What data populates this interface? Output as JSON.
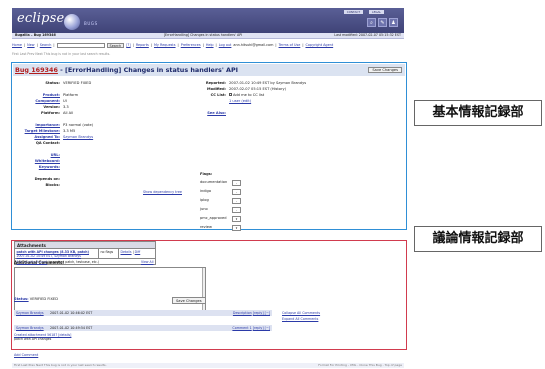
{
  "banner": {
    "wordmark": "eclipse",
    "sub": "BUGS",
    "toplinks": [
      "CONTACT",
      "LEGAL"
    ],
    "icons": [
      "search-icon",
      "edit-icon",
      "user-icon"
    ],
    "icon_glyphs": [
      "⌕",
      "✎",
      "♟"
    ]
  },
  "header": {
    "left": "Bugzilla – Bug 169346",
    "center": "[ErrorHandling] Changes in status handlers' API",
    "right": "Last modified: 2007-02-07 05:15:32 EST"
  },
  "nav": {
    "home": "Home",
    "new": "New",
    "search": "Search",
    "search_button": "Search",
    "help": "[?]",
    "reports": "Reports",
    "my_requests": "My Requests",
    "preferences": "Preferences",
    "help2": "Help",
    "logout": "Log out",
    "user": "ann.hitsuhi@gmail.com",
    "terms": "Terms of Use",
    "copyright": "Copyright Agent",
    "sep": "|"
  },
  "hint": "First Last Prev Next    This bug is not in your last search results.",
  "bug": {
    "number": "Bug 169346",
    "title": " - [ErrorHandling] Changes in status handlers' API",
    "save_label": "Save Changes",
    "left_fields": [
      {
        "k": "Status:",
        "v": "VERIFIED FIXED"
      },
      {
        "k": "",
        "v": ""
      },
      {
        "k": "Product:",
        "v": "Platform"
      },
      {
        "k": "Component:",
        "v": "UI"
      },
      {
        "k": "Version:",
        "v": "3.3"
      },
      {
        "k": "Platform:",
        "v": "All All"
      },
      {
        "k": "",
        "v": ""
      },
      {
        "k": "Importance:",
        "v": "P3 normal (vote)"
      },
      {
        "k": "Target Milestone:",
        "v": "3.3 M5"
      },
      {
        "k": "Assigned To:",
        "v": "Szymon Brandys"
      },
      {
        "k": "QA Contact:",
        "v": ""
      },
      {
        "k": "",
        "v": ""
      },
      {
        "k": "URL:",
        "v": ""
      },
      {
        "k": "Whiteboard:",
        "v": ""
      },
      {
        "k": "Keywords:",
        "v": ""
      },
      {
        "k": "",
        "v": ""
      },
      {
        "k": "Depends on:",
        "v": ""
      },
      {
        "k": "Blocks:",
        "v": ""
      }
    ],
    "dependency_text": "Show dependency tree",
    "reported_label": "Reported:",
    "reported_value": "2007-01-02 10:49 EST by Szymon Brandys",
    "modified_label": "Modified:",
    "modified_value": "2007-02-07 05:15 EST (History)",
    "cc_label": "CC List:",
    "cc_value": "Add me to CC list",
    "cc_users": "1 user (edit)",
    "see_also": "See Also:",
    "flags_title": "Flags:",
    "flags": [
      {
        "name": "documentation",
        "value": "-"
      },
      {
        "name": "indigo",
        "value": "-"
      },
      {
        "name": "iplog",
        "value": "-"
      },
      {
        "name": "juno",
        "value": "-"
      },
      {
        "name": "pmc_approved",
        "value": "▾"
      },
      {
        "name": "review",
        "value": "▾"
      }
    ]
  },
  "attachments": {
    "title": "Attachments",
    "row": {
      "name": "patch with API changes (8.33 KB, patch)",
      "date": "2007-01-02 10:49 EST, Szymon Brandys",
      "flags": "no flags",
      "details": "Details",
      "diff": "Diff"
    },
    "add": "Add an attachment",
    "add_note": "(proposed patch, testcase, etc.)",
    "view_all": "View All"
  },
  "comments_section": {
    "label": "Additional Comments:",
    "status_label": "Status:",
    "status_value": "VERIFIED FIXED",
    "save_label": "Save Changes",
    "comments": [
      {
        "author": "Szymon Brandys",
        "date": "2007-01-02 10:46:02 EST",
        "ref": "Description",
        "links": "[reply] [−]"
      },
      {
        "author": "Szymon Brandys",
        "date": "2007-01-02 10:49:54 EST",
        "ref": "Comment 1",
        "links": "[reply] [−]"
      }
    ],
    "collapse_all": "Collapse All Comments",
    "expand_all": "Expand All Comments",
    "comment1_text": "Created attachment 56187 [details]",
    "comment1_text2": "patch with API changes",
    "add_comment": "Add Comment"
  },
  "footer": {
    "left": "First Last Prev Next    This bug is not in your last search results.",
    "right": "Format For Printing - XML - Clone This Bug - Top of page"
  },
  "annotations": {
    "basic": "基本情報記録部",
    "discussion": "議論情報記録部"
  },
  "colors": {
    "basic_frame": "#2f8fd6",
    "discussion_frame": "#d13b4e",
    "banner": "#4a4e85"
  }
}
